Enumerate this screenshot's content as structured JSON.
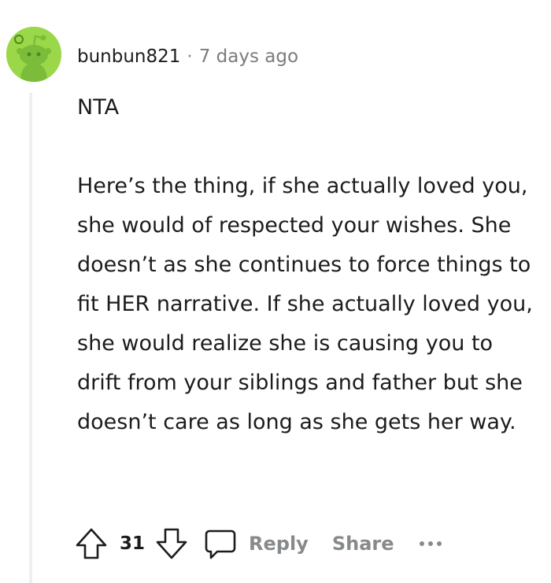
{
  "comment": {
    "username": "bunbun821",
    "separator": "·",
    "timestamp": "7 days ago",
    "verdict": "NTA",
    "body": "Here’s the thing, if she actually loved you, she would of respected your wishes. She doesn’t as she continues to force things to fit HER narrative. If she actually loved you, she would realize she is causing you to drift from your siblings and father but she doesn’t care as long as she gets her way."
  },
  "actions": {
    "upvote_icon": "upvote-arrow-icon",
    "vote_count": "31",
    "downvote_icon": "downvote-arrow-icon",
    "reply_icon": "speech-bubble-icon",
    "reply_label": "Reply",
    "share_label": "Share",
    "more_icon": "ellipsis-icon"
  },
  "colors": {
    "avatar_bg": "#9ad84a",
    "text": "#1c1c1c",
    "muted": "#878a8c",
    "thread_line": "#edeff1"
  }
}
